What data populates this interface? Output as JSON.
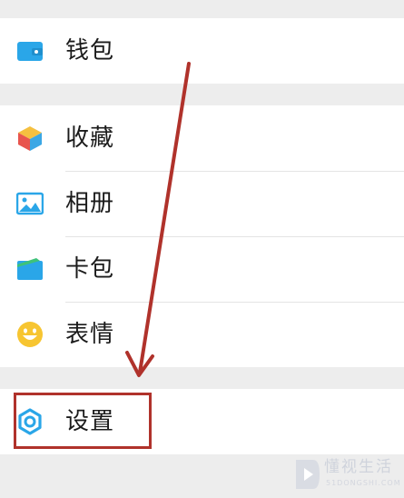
{
  "menu": {
    "wallet": {
      "label": "钱包",
      "icon": "wallet-icon"
    },
    "favorites": {
      "label": "收藏",
      "icon": "cube-icon"
    },
    "album": {
      "label": "相册",
      "icon": "picture-icon"
    },
    "cards": {
      "label": "卡包",
      "icon": "card-icon"
    },
    "stickers": {
      "label": "表情",
      "icon": "smiley-icon"
    },
    "settings": {
      "label": "设置",
      "icon": "gear-icon"
    }
  },
  "annotation": {
    "highlight_color": "#b0322b",
    "target": "settings"
  },
  "watermark": {
    "text": "懂视生活",
    "subtext": "51DONGSHI.COM"
  },
  "colors": {
    "background": "#ededed",
    "row": "#ffffff",
    "accent_blue": "#2aa6e8",
    "annotation_red": "#b0322b"
  }
}
